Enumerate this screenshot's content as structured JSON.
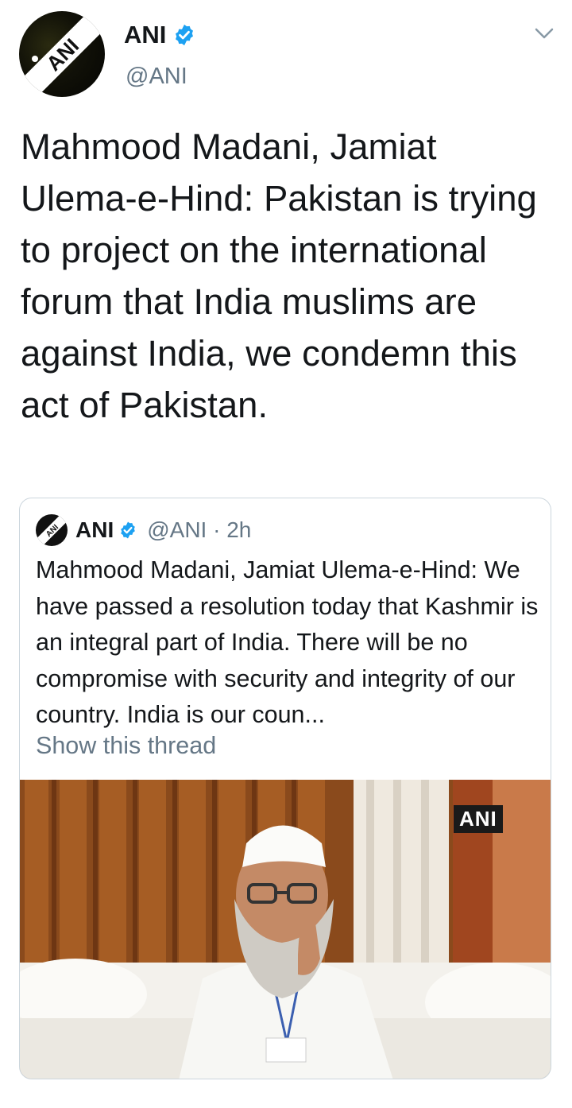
{
  "account": {
    "name": "ANI",
    "handle": "@ANI",
    "avatar_label": "ANI"
  },
  "tweet": {
    "text": "Mahmood Madani, Jamiat Ulema-e-Hind: Pakistan is trying to project on the international forum that India muslims are against India, we condemn this act of Pakistan."
  },
  "quoted_tweet": {
    "name": "ANI",
    "handle_time": "@ANI · 2h",
    "text": "Mahmood Madani, Jamiat Ulema-e-Hind: We have passed a resolution today that Kashmir is an integral part of India. There will be no compromise with security and integrity of our country. India is our coun...",
    "show_thread": "Show this thread",
    "image_watermark": "ANI"
  },
  "icons": {
    "verified": "verified-badge-icon",
    "menu": "chevron-down-icon"
  },
  "colors": {
    "verified_blue": "#1da1f2",
    "secondary_text": "#657786",
    "border": "#ccd6dd"
  }
}
